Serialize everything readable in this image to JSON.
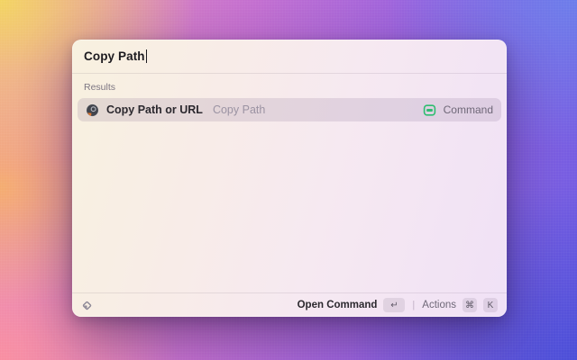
{
  "window": {
    "search": {
      "value": "Copy Path"
    },
    "results_label": "Results",
    "result": {
      "icon": "copy-path-app-icon",
      "title": "Copy Path or URL",
      "subtitle": "Copy Path",
      "type_icon": "command-window-icon",
      "type_label": "Command"
    },
    "footer": {
      "logo_icon": "raycast-logo-icon",
      "primary_action": "Open Command",
      "primary_key": "↵",
      "separator": "|",
      "secondary_action": "Actions",
      "secondary_keys": [
        "⌘",
        "K"
      ]
    }
  },
  "colors": {
    "accent_green": "#2EBD70",
    "app_icon_dark": "#42454d",
    "app_icon_orange": "#e0762f",
    "selection_bg": "rgba(118,93,134,0.16)",
    "wallpaper_corners": {
      "top_left": "#f3d85e",
      "top_right": "#6c7feb",
      "bottom_left": "#fa8fa0",
      "bottom_right": "#4a4ed7",
      "center": "#b06ad0"
    }
  }
}
